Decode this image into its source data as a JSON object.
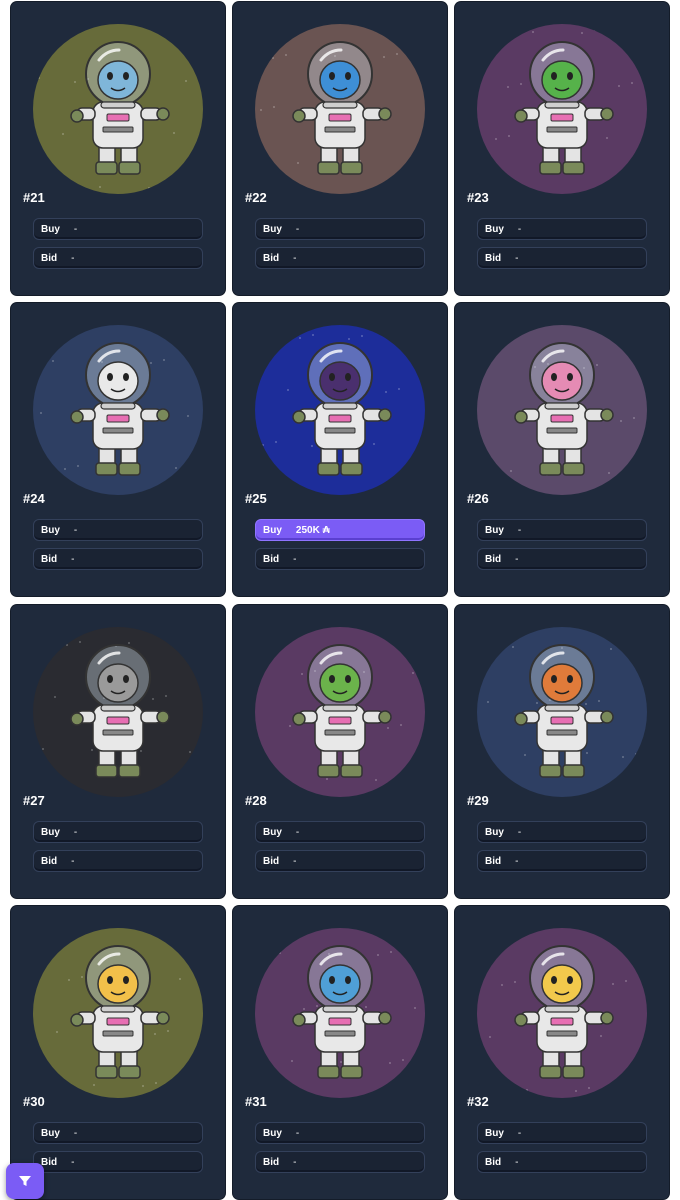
{
  "cards": [
    {
      "number": "#21",
      "buy_label": "Buy",
      "buy_value": "-",
      "bid_label": "Bid",
      "bid_value": "-",
      "bg": "#676b3a",
      "head": "#7fb6d9",
      "species": "blue-tiger-icon"
    },
    {
      "number": "#22",
      "buy_label": "Buy",
      "buy_value": "-",
      "bid_label": "Bid",
      "bid_value": "-",
      "bg": "#6a5452",
      "head": "#3e8fd6",
      "species": "parrot-icon"
    },
    {
      "number": "#23",
      "buy_label": "Buy",
      "buy_value": "-",
      "bid_label": "Bid",
      "bid_value": "-",
      "bg": "#5a3a63",
      "head": "#56b24a",
      "species": "parrot-icon"
    },
    {
      "number": "#24",
      "buy_label": "Buy",
      "buy_value": "-",
      "bid_label": "Bid",
      "bid_value": "-",
      "bg": "#2e3f63",
      "head": "#e9e9e9",
      "species": "dog-icon"
    },
    {
      "number": "#25",
      "buy_label": "Buy",
      "buy_value": "250K ₳",
      "bid_label": "Bid",
      "bid_value": "-",
      "bg": "#1d2d9a",
      "head": "#4a2f6e",
      "species": "dark-helmet-icon",
      "active_buy": true
    },
    {
      "number": "#26",
      "buy_label": "Buy",
      "buy_value": "-",
      "bid_label": "Bid",
      "bid_value": "-",
      "bg": "#5b4a6a",
      "head": "#e58bb4",
      "species": "lion-icon"
    },
    {
      "number": "#27",
      "buy_label": "Buy",
      "buy_value": "-",
      "bid_label": "Bid",
      "bid_value": "-",
      "bg": "#2a2b31",
      "head": "#9a9a9a",
      "species": "elephant-icon"
    },
    {
      "number": "#28",
      "buy_label": "Buy",
      "buy_value": "-",
      "bid_label": "Bid",
      "bid_value": "-",
      "bg": "#5a3a63",
      "head": "#6bb34b",
      "species": "frog-icon"
    },
    {
      "number": "#29",
      "buy_label": "Buy",
      "buy_value": "-",
      "bid_label": "Bid",
      "bid_value": "-",
      "bg": "#2e3f63",
      "head": "#e07b3a",
      "species": "tiger-icon"
    },
    {
      "number": "#30",
      "buy_label": "Buy",
      "buy_value": "-",
      "bid_label": "Bid",
      "bid_value": "-",
      "bg": "#676b3a",
      "head": "#f2c04a",
      "species": "tiger-icon"
    },
    {
      "number": "#31",
      "buy_label": "Buy",
      "buy_value": "-",
      "bid_label": "Bid",
      "bid_value": "-",
      "bg": "#5a3a63",
      "head": "#4f9fd6",
      "species": "cat-icon"
    },
    {
      "number": "#32",
      "buy_label": "Buy",
      "buy_value": "-",
      "bid_label": "Bid",
      "bid_value": "-",
      "bg": "#5a3a63",
      "head": "#f2c94c",
      "species": "robot-icon"
    }
  ],
  "filter_button": {
    "icon": "filter-icon",
    "color": "#7b5cf5"
  }
}
